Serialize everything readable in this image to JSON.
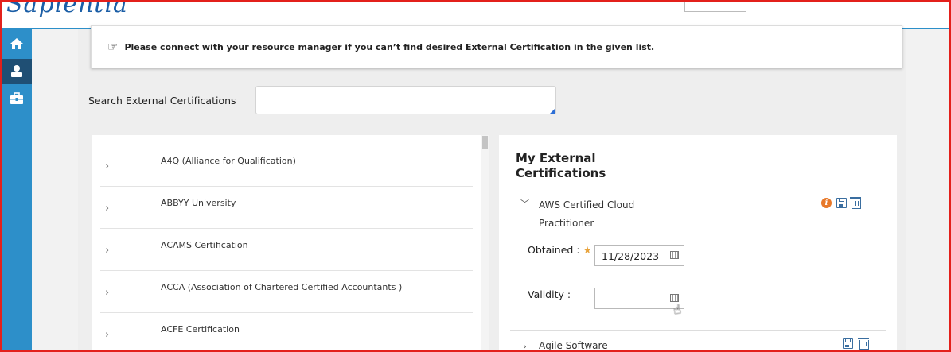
{
  "app": {
    "logo_text": "Sapientia"
  },
  "notice": {
    "icon": "pointing-hand-icon",
    "text": "Please connect with your resource manager if you can’t find desired External Certification in the given list."
  },
  "search": {
    "label": "Search External Certifications",
    "value": "",
    "placeholder": ""
  },
  "sidebar": {
    "items": [
      {
        "icon": "home-icon",
        "active": false
      },
      {
        "icon": "user-icon",
        "active": true
      },
      {
        "icon": "briefcase-icon",
        "active": false
      }
    ]
  },
  "certifications_list": [
    {
      "name": "A4Q (Alliance for Qualification)"
    },
    {
      "name": "ABBYY University"
    },
    {
      "name": "ACAMS Certification"
    },
    {
      "name": "ACCA (Association of Chartered Certified Accountants )"
    },
    {
      "name": "ACFE Certification"
    }
  ],
  "my_certifications": {
    "title": "My External Certifications",
    "items": [
      {
        "name": "AWS Certified Cloud Practitioner",
        "expanded": true,
        "obtained_label": "Obtained :",
        "required_marker": "★",
        "obtained_value": "11/28/2023",
        "validity_label": "Validity :",
        "validity_value": ""
      },
      {
        "name": "Agile Software",
        "expanded": false
      }
    ]
  },
  "colors": {
    "accent": "#2d8fc9",
    "sidebar_active": "#1f4f74",
    "info_orange": "#e8792a",
    "required_star": "#e8a33c",
    "frame_red": "#e3201b"
  }
}
